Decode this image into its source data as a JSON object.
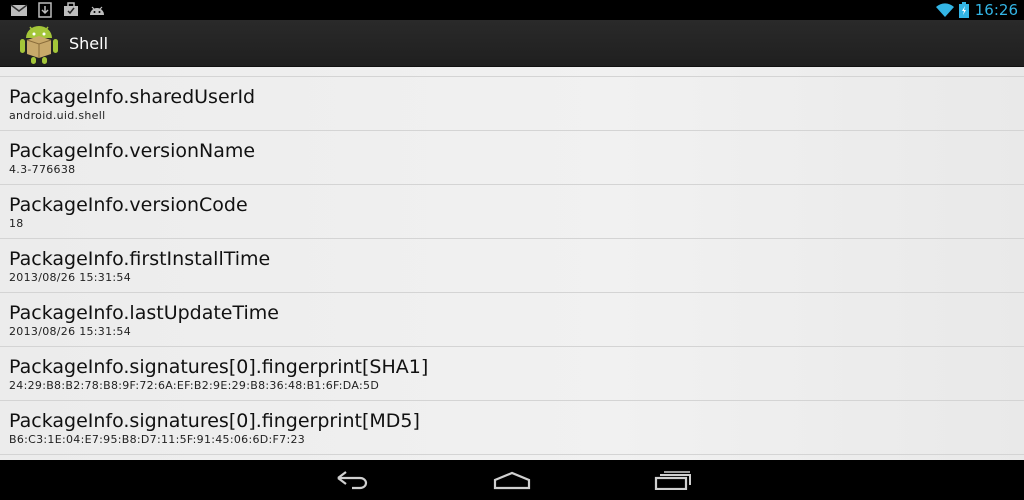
{
  "status_bar": {
    "left_icons": [
      "gmail-icon",
      "download-icon",
      "briefcase-icon",
      "android-debug-icon"
    ],
    "time": "16:26",
    "accent_color": "#33b5e5"
  },
  "action_bar": {
    "title": "Shell",
    "icon": "android-package-icon"
  },
  "list": {
    "items": [
      {
        "title": "PackageInfo.sharedUserId",
        "value": "android.uid.shell"
      },
      {
        "title": "PackageInfo.versionName",
        "value": "4.3-776638"
      },
      {
        "title": "PackageInfo.versionCode",
        "value": "18"
      },
      {
        "title": "PackageInfo.firstInstallTime",
        "value": "2013/08/26 15:31:54"
      },
      {
        "title": "PackageInfo.lastUpdateTime",
        "value": "2013/08/26 15:31:54"
      },
      {
        "title": "PackageInfo.signatures[0].fingerprint[SHA1]",
        "value": "24:29:B8:B2:78:B8:9F:72:6A:EF:B2:9E:29:B8:36:48:B1:6F:DA:5D"
      },
      {
        "title": "PackageInfo.signatures[0].fingerprint[MD5]",
        "value": "B6:C3:1E:04:E7:95:B8:D7:11:5F:91:45:06:6D:F7:23"
      }
    ]
  },
  "nav_bar": {
    "buttons": [
      "back-icon",
      "home-icon",
      "recents-icon"
    ]
  }
}
